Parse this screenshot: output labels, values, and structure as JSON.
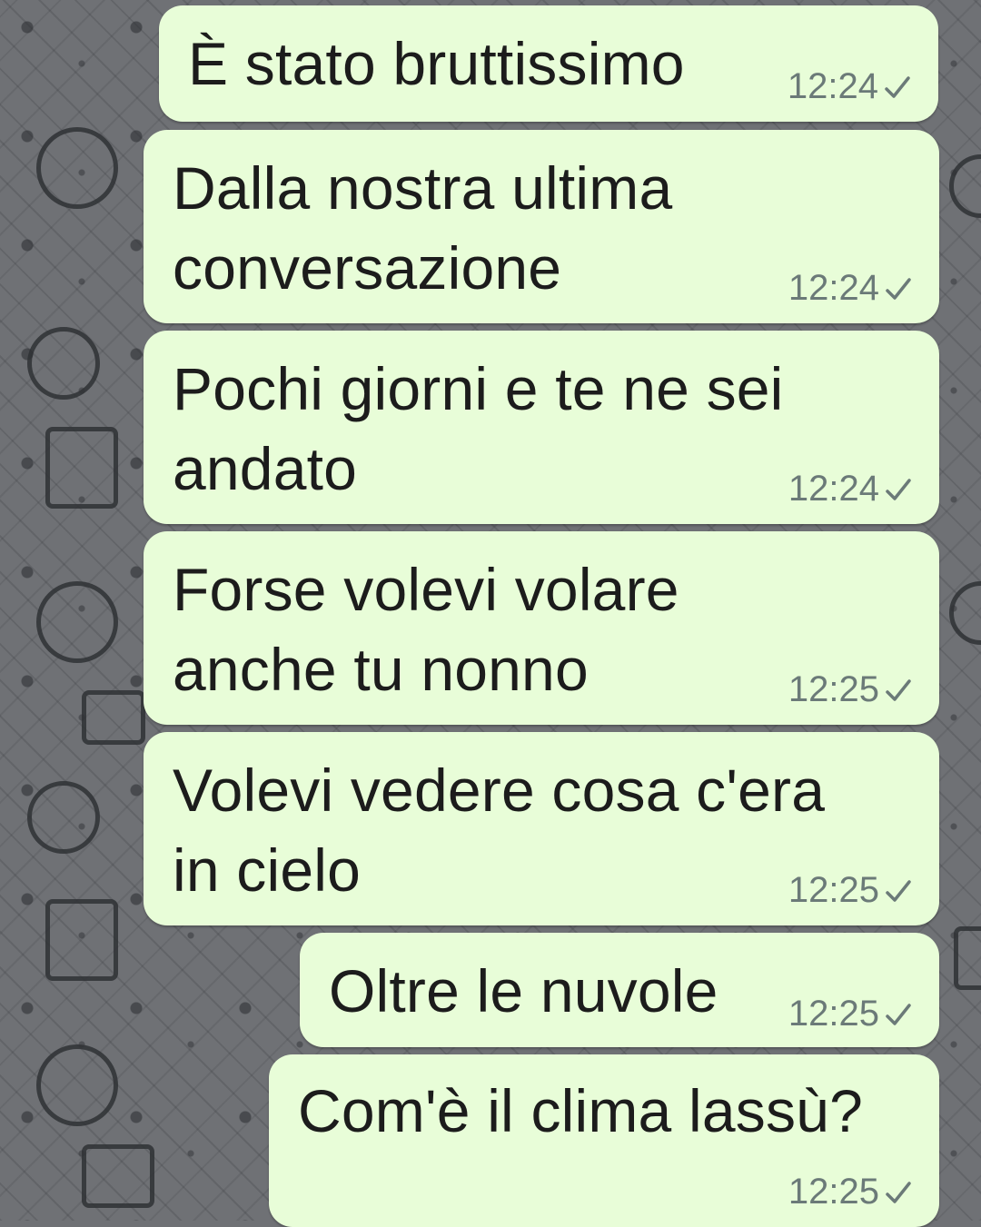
{
  "chat": {
    "messages": [
      {
        "text": "È stato bruttissimo",
        "time": "12:24",
        "status": "sent"
      },
      {
        "text": "Dalla nostra ultima\nconversazione",
        "time": "12:24",
        "status": "sent"
      },
      {
        "text": "Pochi giorni e te ne sei\nandato",
        "time": "12:24",
        "status": "sent"
      },
      {
        "text": "Forse volevi volare\nanche tu nonno",
        "time": "12:25",
        "status": "sent"
      },
      {
        "text": "Volevi vedere cosa c'era\nin cielo",
        "time": "12:25",
        "status": "sent"
      },
      {
        "text": "Oltre le nuvole",
        "time": "12:25",
        "status": "sent"
      },
      {
        "text": "Com'è il clima lassù?",
        "time": "12:25",
        "status": "sent"
      }
    ],
    "icons": {
      "status_icon": "single-check-icon"
    },
    "colors": {
      "bubble": "#e8fdd8",
      "background": "#6f7175",
      "text": "#1c1c1c",
      "meta": "#6b7a78"
    }
  }
}
